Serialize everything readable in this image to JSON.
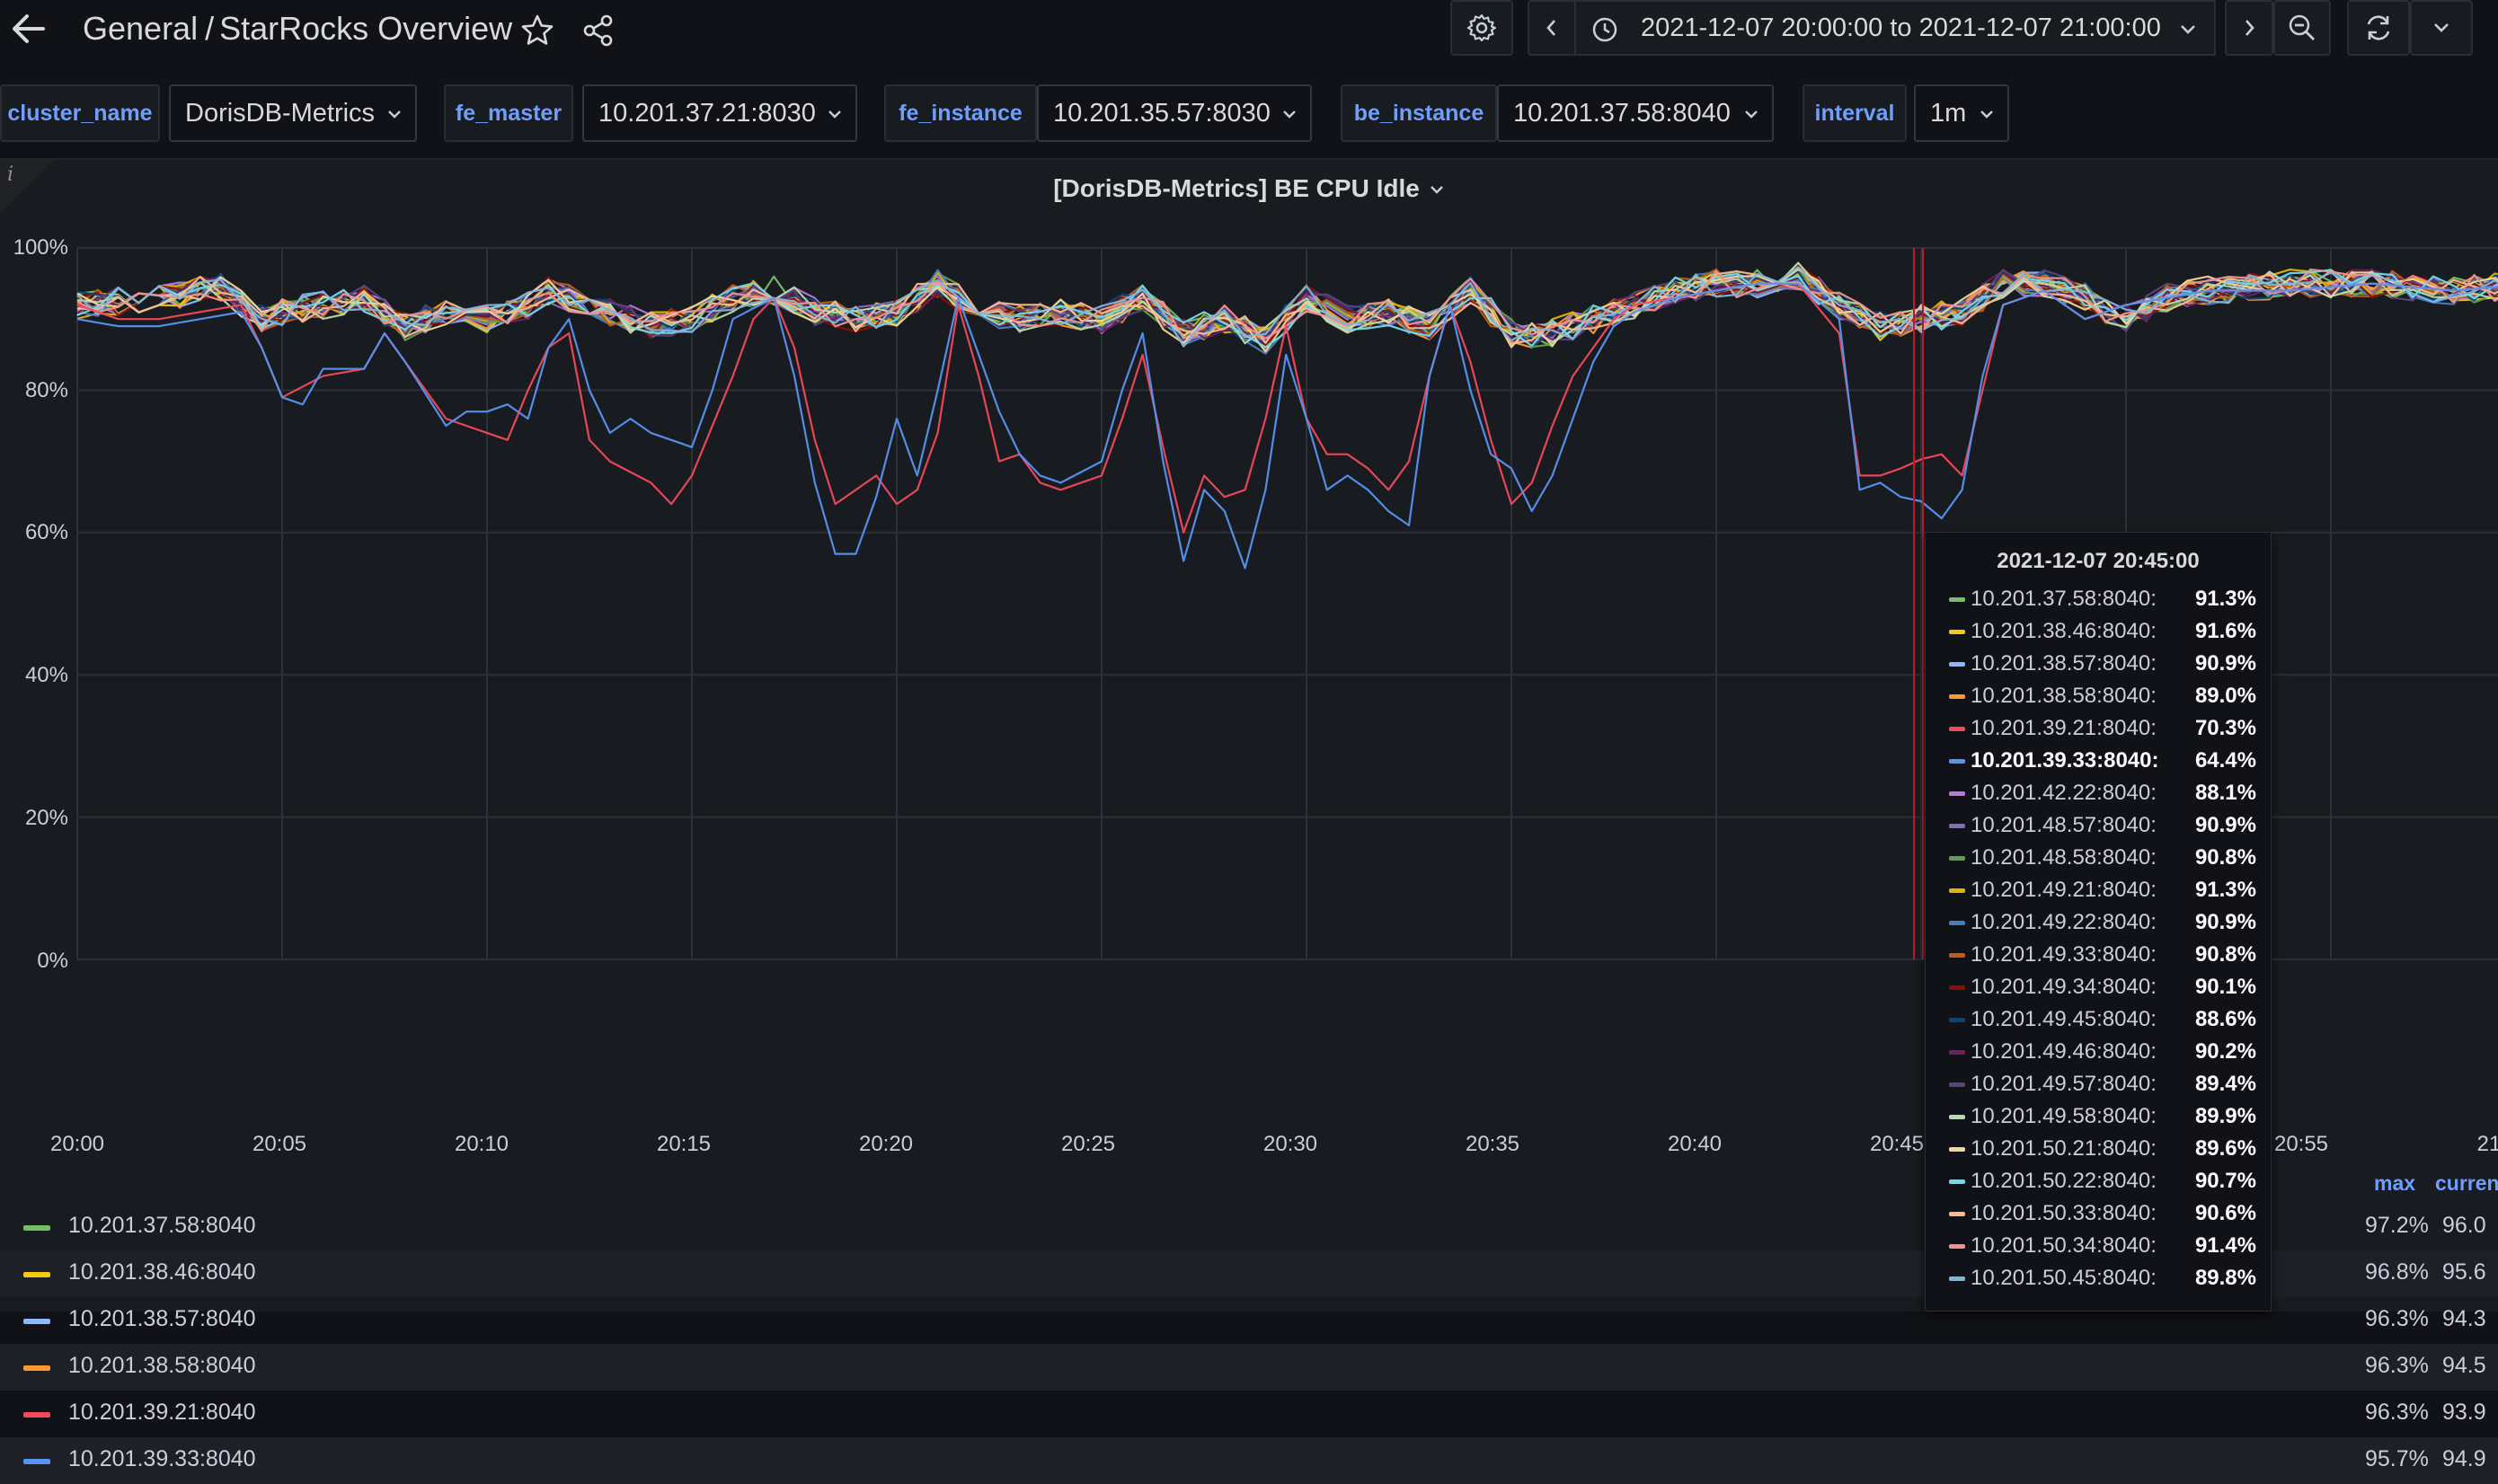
{
  "header": {
    "folder": "General",
    "separator": "/",
    "dashboard_title": "StarRocks Overview",
    "time_range": "2021-12-07 20:00:00 to 2021-12-07 21:00:00"
  },
  "variables": [
    {
      "label": "cluster_name",
      "value": "DorisDB-Metrics"
    },
    {
      "label": "fe_master",
      "value": "10.201.37.21:8030"
    },
    {
      "label": "fe_instance",
      "value": "10.201.35.57:8030"
    },
    {
      "label": "be_instance",
      "value": "10.201.37.58:8040"
    },
    {
      "label": "interval",
      "value": "1m"
    }
  ],
  "panel": {
    "info_icon": "i",
    "title": "[DorisDB-Metrics] BE CPU Idle"
  },
  "chart_data": {
    "type": "line",
    "title": "[DorisDB-Metrics] BE CPU Idle",
    "y_ticks": [
      "100%",
      "80%",
      "60%",
      "40%",
      "20%",
      "0%"
    ],
    "ylim": [
      0,
      100
    ],
    "x_ticks": [
      "20:00",
      "20:05",
      "20:10",
      "20:15",
      "20:20",
      "20:25",
      "20:30",
      "20:35",
      "20:40",
      "20:45",
      "20:55",
      "21"
    ],
    "xlim_minutes": [
      0,
      60
    ],
    "grid": true,
    "cursor_time": "2021-12-07 20:45:00",
    "cursor_minute": 45,
    "series": [
      {
        "name": "10.201.37.58:8040",
        "color": "#73bf69",
        "band": "normal"
      },
      {
        "name": "10.201.38.46:8040",
        "color": "#f2cc0c",
        "band": "normal"
      },
      {
        "name": "10.201.38.57:8040",
        "color": "#8ab8ff",
        "band": "normal"
      },
      {
        "name": "10.201.38.58:8040",
        "color": "#ff9830",
        "band": "normal"
      },
      {
        "name": "10.201.39.21:8040",
        "color": "#f2495c",
        "band": "low",
        "points": [
          [
            0,
            92
          ],
          [
            1,
            90
          ],
          [
            2,
            90
          ],
          [
            3,
            91
          ],
          [
            4,
            92
          ],
          [
            4.5,
            86
          ],
          [
            5,
            79
          ],
          [
            6,
            82
          ],
          [
            7,
            83
          ],
          [
            7.5,
            88
          ],
          [
            8,
            84
          ],
          [
            9,
            76
          ],
          [
            10,
            74
          ],
          [
            10.5,
            73
          ],
          [
            11,
            80
          ],
          [
            11.5,
            86
          ],
          [
            12,
            88
          ],
          [
            12.5,
            73
          ],
          [
            13,
            70
          ],
          [
            14,
            67
          ],
          [
            14.5,
            64
          ],
          [
            15,
            68
          ],
          [
            16,
            82
          ],
          [
            16.5,
            90
          ],
          [
            17,
            93
          ],
          [
            17.5,
            86
          ],
          [
            18,
            73
          ],
          [
            18.5,
            64
          ],
          [
            19,
            66
          ],
          [
            19.5,
            68
          ],
          [
            20,
            64
          ],
          [
            20.5,
            66
          ],
          [
            21,
            74
          ],
          [
            21.5,
            92
          ],
          [
            22,
            82
          ],
          [
            22.5,
            70
          ],
          [
            23,
            71
          ],
          [
            23.5,
            67
          ],
          [
            24,
            66
          ],
          [
            25,
            68
          ],
          [
            25.5,
            76
          ],
          [
            26,
            85
          ],
          [
            26.5,
            72
          ],
          [
            27,
            60
          ],
          [
            27.5,
            68
          ],
          [
            28,
            65
          ],
          [
            28.5,
            66
          ],
          [
            29,
            76
          ],
          [
            29.5,
            89
          ],
          [
            30,
            76
          ],
          [
            30.5,
            71
          ],
          [
            31,
            71
          ],
          [
            31.5,
            69
          ],
          [
            32,
            66
          ],
          [
            32.5,
            70
          ],
          [
            33,
            82
          ],
          [
            33.5,
            92
          ],
          [
            34,
            84
          ],
          [
            34.5,
            73
          ],
          [
            35,
            64
          ],
          [
            35.5,
            67
          ],
          [
            36,
            75
          ],
          [
            36.5,
            82
          ],
          [
            37,
            86
          ],
          [
            37.5,
            90
          ],
          [
            38,
            92
          ],
          [
            39,
            93
          ],
          [
            40,
            94
          ],
          [
            41,
            95
          ],
          [
            42,
            95
          ],
          [
            43,
            88
          ],
          [
            43.5,
            68
          ],
          [
            44,
            68
          ],
          [
            44.5,
            69
          ],
          [
            45,
            70.3
          ],
          [
            45.5,
            71
          ],
          [
            46,
            68
          ],
          [
            46.5,
            80
          ],
          [
            47,
            92
          ],
          [
            48,
            94
          ],
          [
            49,
            90
          ],
          [
            50,
            92
          ],
          [
            52,
            94
          ],
          [
            54,
            94
          ],
          [
            56,
            95
          ],
          [
            58,
            94
          ],
          [
            60,
            95
          ]
        ]
      },
      {
        "name": "10.201.39.33:8040",
        "color": "#5794f2",
        "band": "low",
        "points": [
          [
            0,
            90
          ],
          [
            1,
            89
          ],
          [
            2,
            89
          ],
          [
            3,
            90
          ],
          [
            4,
            91
          ],
          [
            4.5,
            86
          ],
          [
            5,
            79
          ],
          [
            5.5,
            78
          ],
          [
            6,
            83
          ],
          [
            7,
            83
          ],
          [
            7.5,
            88
          ],
          [
            8,
            84
          ],
          [
            9,
            75
          ],
          [
            9.5,
            77
          ],
          [
            10,
            77
          ],
          [
            10.5,
            78
          ],
          [
            11,
            76
          ],
          [
            11.5,
            86
          ],
          [
            12,
            90
          ],
          [
            12.5,
            80
          ],
          [
            13,
            74
          ],
          [
            13.5,
            76
          ],
          [
            14,
            74
          ],
          [
            14.5,
            73
          ],
          [
            15,
            72
          ],
          [
            15.5,
            80
          ],
          [
            16,
            90
          ],
          [
            17,
            93
          ],
          [
            17.5,
            82
          ],
          [
            18,
            67
          ],
          [
            18.5,
            57
          ],
          [
            19,
            57
          ],
          [
            19.5,
            65
          ],
          [
            20,
            76
          ],
          [
            20.5,
            68
          ],
          [
            21,
            80
          ],
          [
            21.5,
            93
          ],
          [
            22,
            85
          ],
          [
            22.5,
            77
          ],
          [
            23,
            71
          ],
          [
            23.5,
            68
          ],
          [
            24,
            67
          ],
          [
            25,
            70
          ],
          [
            25.5,
            80
          ],
          [
            26,
            88
          ],
          [
            26.5,
            70
          ],
          [
            27,
            56
          ],
          [
            27.5,
            66
          ],
          [
            28,
            63
          ],
          [
            28.5,
            55
          ],
          [
            29,
            66
          ],
          [
            29.5,
            85
          ],
          [
            30,
            76
          ],
          [
            30.5,
            66
          ],
          [
            31,
            68
          ],
          [
            31.5,
            66
          ],
          [
            32,
            63
          ],
          [
            32.5,
            61
          ],
          [
            33,
            82
          ],
          [
            33.5,
            92
          ],
          [
            34,
            80
          ],
          [
            34.5,
            71
          ],
          [
            35,
            69
          ],
          [
            35.5,
            63
          ],
          [
            36,
            68
          ],
          [
            36.5,
            76
          ],
          [
            37,
            84
          ],
          [
            37.5,
            89
          ],
          [
            38,
            91
          ],
          [
            39,
            93
          ],
          [
            40,
            94
          ],
          [
            41,
            95
          ],
          [
            42,
            95
          ],
          [
            43,
            90
          ],
          [
            43.5,
            66
          ],
          [
            44,
            67
          ],
          [
            44.5,
            65
          ],
          [
            45,
            64.4
          ],
          [
            45.5,
            62
          ],
          [
            46,
            66
          ],
          [
            46.5,
            82
          ],
          [
            47,
            92
          ],
          [
            48,
            94
          ],
          [
            49,
            90
          ],
          [
            50,
            92
          ],
          [
            52,
            94
          ],
          [
            54,
            94
          ],
          [
            56,
            95
          ],
          [
            58,
            94
          ],
          [
            60,
            95
          ]
        ]
      },
      {
        "name": "10.201.42.22:8040",
        "color": "#b877d9",
        "band": "normal"
      },
      {
        "name": "10.201.48.57:8040",
        "color": "#806eb7",
        "band": "normal"
      },
      {
        "name": "10.201.48.58:8040",
        "color": "#629e51",
        "band": "normal"
      },
      {
        "name": "10.201.49.21:8040",
        "color": "#e0b400",
        "band": "normal"
      },
      {
        "name": "10.201.49.22:8040",
        "color": "#447ebc",
        "band": "normal"
      },
      {
        "name": "10.201.49.33:8040",
        "color": "#c15c17",
        "band": "normal"
      },
      {
        "name": "10.201.49.34:8040",
        "color": "#890f02",
        "band": "normal"
      },
      {
        "name": "10.201.49.45:8040",
        "color": "#0a437c",
        "band": "normal"
      },
      {
        "name": "10.201.49.46:8040",
        "color": "#6d1f62",
        "band": "normal"
      },
      {
        "name": "10.201.49.57:8040",
        "color": "#584477",
        "band": "normal"
      },
      {
        "name": "10.201.49.58:8040",
        "color": "#b7dbab",
        "band": "normal"
      },
      {
        "name": "10.201.50.21:8040",
        "color": "#f4d598",
        "band": "normal"
      },
      {
        "name": "10.201.50.22:8040",
        "color": "#70dbed",
        "band": "normal"
      },
      {
        "name": "10.201.50.33:8040",
        "color": "#f9ba8f",
        "band": "normal"
      },
      {
        "name": "10.201.50.34:8040",
        "color": "#f29191",
        "band": "normal"
      },
      {
        "name": "10.201.50.45:8040",
        "color": "#82b5d8",
        "band": "normal"
      }
    ]
  },
  "tooltip": {
    "title": "2021-12-07 20:45:00",
    "highlighted": "10.201.39.33:8040:",
    "rows": [
      {
        "name": "10.201.37.58:8040:",
        "value": "91.3%",
        "color": "#73bf69"
      },
      {
        "name": "10.201.38.46:8040:",
        "value": "91.6%",
        "color": "#f2cc0c"
      },
      {
        "name": "10.201.38.57:8040:",
        "value": "90.9%",
        "color": "#8ab8ff"
      },
      {
        "name": "10.201.38.58:8040:",
        "value": "89.0%",
        "color": "#ff9830"
      },
      {
        "name": "10.201.39.21:8040:",
        "value": "70.3%",
        "color": "#f2495c"
      },
      {
        "name": "10.201.39.33:8040:",
        "value": "64.4%",
        "color": "#5794f2"
      },
      {
        "name": "10.201.42.22:8040:",
        "value": "88.1%",
        "color": "#b877d9"
      },
      {
        "name": "10.201.48.57:8040:",
        "value": "90.9%",
        "color": "#806eb7"
      },
      {
        "name": "10.201.48.58:8040:",
        "value": "90.8%",
        "color": "#629e51"
      },
      {
        "name": "10.201.49.21:8040:",
        "value": "91.3%",
        "color": "#e0b400"
      },
      {
        "name": "10.201.49.22:8040:",
        "value": "90.9%",
        "color": "#447ebc"
      },
      {
        "name": "10.201.49.33:8040:",
        "value": "90.8%",
        "color": "#c15c17"
      },
      {
        "name": "10.201.49.34:8040:",
        "value": "90.1%",
        "color": "#890f02"
      },
      {
        "name": "10.201.49.45:8040:",
        "value": "88.6%",
        "color": "#0a437c"
      },
      {
        "name": "10.201.49.46:8040:",
        "value": "90.2%",
        "color": "#6d1f62"
      },
      {
        "name": "10.201.49.57:8040:",
        "value": "89.4%",
        "color": "#584477"
      },
      {
        "name": "10.201.49.58:8040:",
        "value": "89.9%",
        "color": "#b7dbab"
      },
      {
        "name": "10.201.50.21:8040:",
        "value": "89.6%",
        "color": "#f4d598"
      },
      {
        "name": "10.201.50.22:8040:",
        "value": "90.7%",
        "color": "#70dbed"
      },
      {
        "name": "10.201.50.33:8040:",
        "value": "90.6%",
        "color": "#f9ba8f"
      },
      {
        "name": "10.201.50.34:8040:",
        "value": "91.4%",
        "color": "#f29191"
      },
      {
        "name": "10.201.50.45:8040:",
        "value": "89.8%",
        "color": "#82b5d8"
      }
    ]
  },
  "legend": {
    "headers": {
      "max": "max",
      "current": "curren"
    },
    "rows": [
      {
        "name": "10.201.37.58:8040",
        "color": "#73bf69",
        "max": "97.2%",
        "current": "96.0"
      },
      {
        "name": "10.201.38.46:8040",
        "color": "#f2cc0c",
        "max": "96.8%",
        "current": "95.6"
      },
      {
        "name": "10.201.38.57:8040",
        "color": "#8ab8ff",
        "max": "96.3%",
        "current": "94.3"
      },
      {
        "name": "10.201.38.58:8040",
        "color": "#ff9830",
        "max": "96.3%",
        "current": "94.5"
      },
      {
        "name": "10.201.39.21:8040",
        "color": "#f2495c",
        "max": "96.3%",
        "current": "93.9"
      },
      {
        "name": "10.201.39.33:8040",
        "color": "#5794f2",
        "max": "95.7%",
        "current": "94.9"
      }
    ]
  }
}
